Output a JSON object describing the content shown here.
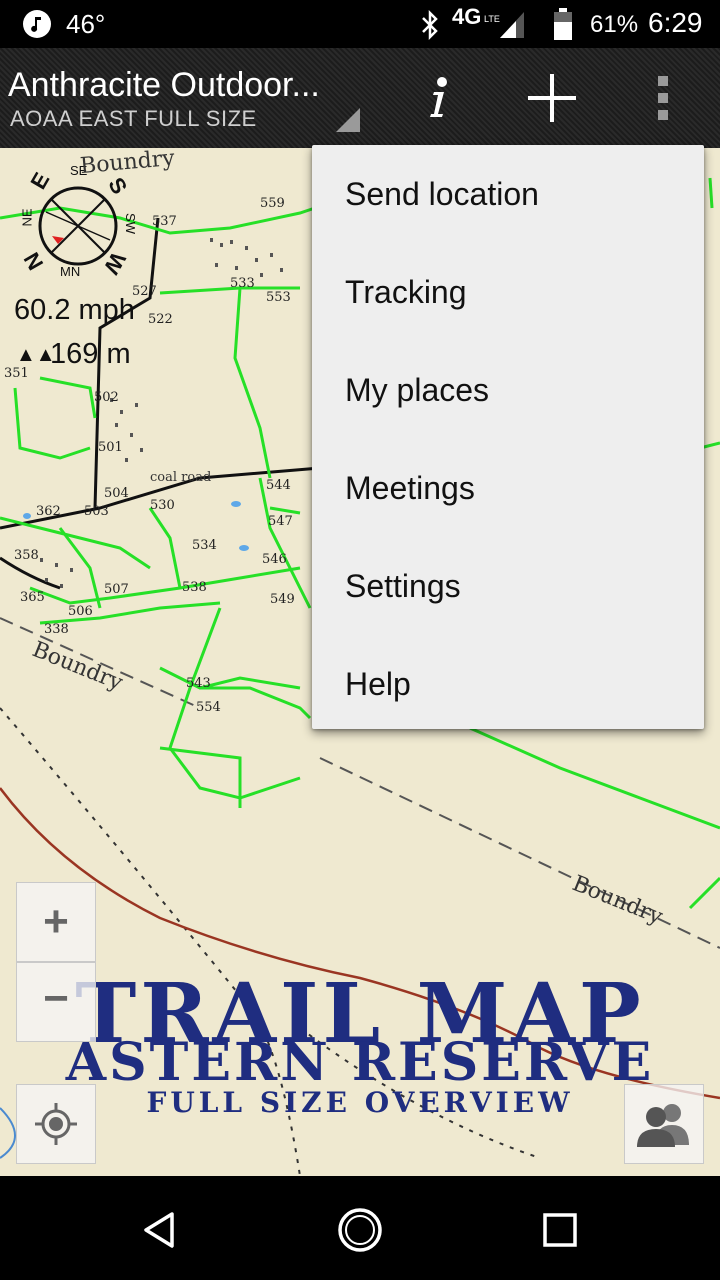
{
  "status_bar": {
    "temperature": "46°",
    "network": "4G",
    "network_sub": "LTE",
    "battery": "61%",
    "time": "6:29"
  },
  "app_bar": {
    "title": "Anthracite Outdoor...",
    "subtitle": "AOAA EAST FULL SIZE"
  },
  "menu": {
    "items": [
      "Send location",
      "Tracking",
      "My places",
      "Meetings",
      "Settings",
      "Help"
    ]
  },
  "map": {
    "speed": "60.2 mph",
    "altitude": "169 m",
    "compass_labels": [
      "E",
      "S",
      "SE",
      "NE",
      "SW",
      "MN",
      "N",
      "W"
    ],
    "labels": {
      "boundary": "Boundry",
      "coal_road": "coal road",
      "trails": [
        "559",
        "537",
        "533",
        "553",
        "527",
        "522",
        "502",
        "501",
        "504",
        "503",
        "530",
        "544",
        "547",
        "534",
        "546",
        "549",
        "507",
        "538",
        "506",
        "543",
        "554",
        "358",
        "365",
        "338",
        "351",
        "362"
      ]
    },
    "banner_title": "TRAIL MAP",
    "banner_subtitle": "ASTERN RESERVE",
    "banner_caption": "FULL SIZE OVERVIEW"
  },
  "zoom": {
    "in_label": "+",
    "out_label": "−"
  },
  "colors": {
    "trail": "#26e027",
    "banner": "#1f2d80",
    "map_bg": "#efe9d0",
    "menu_bg": "#eeeeee"
  }
}
